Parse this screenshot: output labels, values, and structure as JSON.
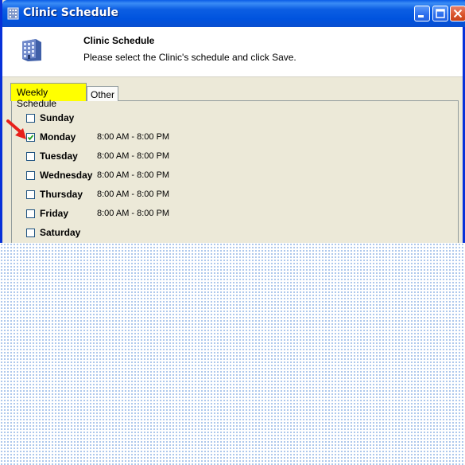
{
  "window": {
    "title": "Clinic Schedule",
    "buttons": [
      "minimize",
      "maximize",
      "close"
    ],
    "icon": "building-icon"
  },
  "header": {
    "title": "Clinic Schedule",
    "subtitle": "Please select the Clinic's schedule and click Save.",
    "icon": "building-icon"
  },
  "tabs": [
    {
      "label": "Weekly Schedule",
      "active": true,
      "highlight": "#ffff00"
    },
    {
      "label": "Other",
      "active": false
    }
  ],
  "days": [
    {
      "name": "Sunday",
      "checked": false,
      "hours": ""
    },
    {
      "name": "Monday",
      "checked": true,
      "hours": "8:00 AM - 8:00 PM"
    },
    {
      "name": "Tuesday",
      "checked": false,
      "hours": "8:00 AM - 8:00 PM"
    },
    {
      "name": "Wednesday",
      "checked": false,
      "hours": "8:00 AM - 8:00 PM"
    },
    {
      "name": "Thursday",
      "checked": false,
      "hours": "8:00 AM - 8:00 PM"
    },
    {
      "name": "Friday",
      "checked": false,
      "hours": "8:00 AM - 8:00 PM"
    },
    {
      "name": "Saturday",
      "checked": false,
      "hours": ""
    }
  ],
  "annotation": {
    "icon": "red-arrow-icon",
    "color": "#e8201a"
  }
}
